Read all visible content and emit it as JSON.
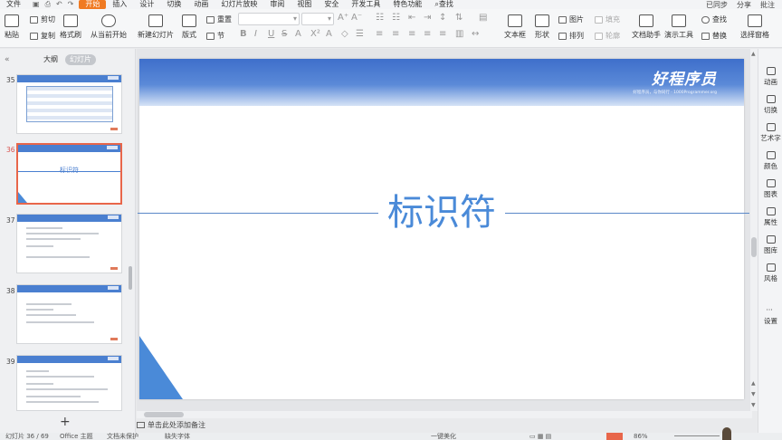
{
  "menubar": {
    "items": [
      "文件",
      "开始",
      "插入",
      "设计",
      "切换",
      "动画",
      "幻灯片放映",
      "审阅",
      "视图",
      "安全",
      "开发工具",
      "特色功能",
      "查找"
    ],
    "active": "开始",
    "right": [
      "已同步",
      "分享",
      "批注"
    ]
  },
  "ribbon": {
    "paste": "粘贴",
    "cut": "剪切",
    "copy": "复制",
    "format_painter": "格式刷",
    "start_from_current": "从当前开始",
    "new_slide": "新建幻灯片",
    "layout": "版式",
    "section": "节",
    "reset": "重置",
    "picture": "图片",
    "fill": "填充",
    "textbox": "文本框",
    "shape": "形状",
    "arrange": "排列",
    "outline": "轮廓",
    "doc_assistant": "文档助手",
    "presentation_tools": "演示工具",
    "find": "查找",
    "replace": "替换",
    "select_pane": "选择窗格"
  },
  "left_panel": {
    "tab_outline": "大纲",
    "tab_slides": "幻灯片",
    "slides": [
      {
        "num": "35"
      },
      {
        "num": "36",
        "title": "标识符",
        "selected": true
      },
      {
        "num": "37"
      },
      {
        "num": "38"
      },
      {
        "num": "39"
      }
    ],
    "add": "+"
  },
  "slide": {
    "title": "标识符",
    "logo_main": "好程序员",
    "logo_sub": "好程序员，与你同行 · 1000Programmer.org"
  },
  "right_sidebar": [
    "动画",
    "切换",
    "艺术字",
    "颜色",
    "图表",
    "属性",
    "图库",
    "风格",
    "设置"
  ],
  "notes_placeholder": "单击此处添加备注",
  "status": {
    "slide_count": "幻灯片 36 / 69",
    "theme": "Office 主题",
    "doc_protect": "文档未保护",
    "missing_font": "缺失字体",
    "beautify": "一键美化",
    "zoom": "86%"
  },
  "colors": {
    "accent": "#f07a22",
    "slide_blue": "#4a8ad8",
    "selected_border": "#e8664a"
  }
}
